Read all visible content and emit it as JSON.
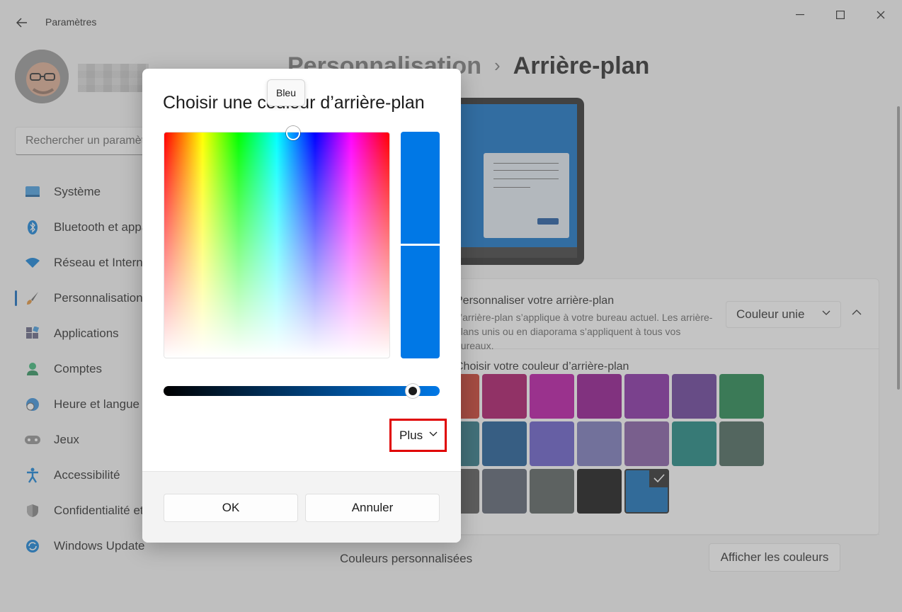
{
  "window": {
    "title": "Paramètres",
    "controls": {
      "minimize_icon": "minimize-icon",
      "maximize_icon": "maximize-icon",
      "close_icon": "close-icon"
    }
  },
  "search": {
    "placeholder": "Rechercher un paramètre"
  },
  "sidebar": {
    "items": [
      {
        "label": "Système",
        "icon": "system-icon"
      },
      {
        "label": "Bluetooth et appareils",
        "icon": "bluetooth-icon"
      },
      {
        "label": "Réseau et Internet",
        "icon": "wifi-icon"
      },
      {
        "label": "Personnalisation",
        "icon": "brush-icon",
        "active": true
      },
      {
        "label": "Applications",
        "icon": "apps-icon"
      },
      {
        "label": "Comptes",
        "icon": "account-icon"
      },
      {
        "label": "Heure et langue",
        "icon": "globe-clock-icon"
      },
      {
        "label": "Jeux",
        "icon": "gamepad-icon"
      },
      {
        "label": "Accessibilité",
        "icon": "accessibility-icon"
      },
      {
        "label": "Confidentialité et sécurité",
        "icon": "shield-icon"
      },
      {
        "label": "Windows Update",
        "icon": "update-icon"
      }
    ]
  },
  "breadcrumb": {
    "parent": "Personnalisation",
    "separator": "›",
    "current": "Arrière-plan"
  },
  "background_card": {
    "title": "Personnaliser votre arrière-plan",
    "description": "L’arrière-plan s’applique à votre bureau actuel. Les arrière-plans unis ou en diaporama s’appliquent à tous vos bureaux.",
    "dropdown_value": "Couleur unie"
  },
  "palette": {
    "label": "Choisir votre couleur d’arrière-plan",
    "rows": [
      [
        "#c42b1c",
        "#a4005a",
        "#b4009e",
        "#880085",
        "#7c1a9e",
        "#5c2e91",
        "#107c41"
      ],
      [
        "#1d6b7b",
        "#0a4d8c",
        "#5a4fc4",
        "#6e6db5",
        "#7a4f9e",
        "#0a7d75",
        "#3a5a4f"
      ],
      [
        "#4a4a4a",
        "#4c5564",
        "#4a5352",
        "#000000",
        "#0063b1"
      ]
    ],
    "selected": "#0063b1"
  },
  "custom_colors": {
    "label": "Couleurs personnalisées",
    "button_label": "Afficher les couleurs"
  },
  "dialog": {
    "title": "Choisir une couleur d’arrière-plan",
    "tooltip": "Bleu",
    "current_color": "#0078e6",
    "more_label": "Plus",
    "ok_label": "OK",
    "cancel_label": "Annuler"
  }
}
